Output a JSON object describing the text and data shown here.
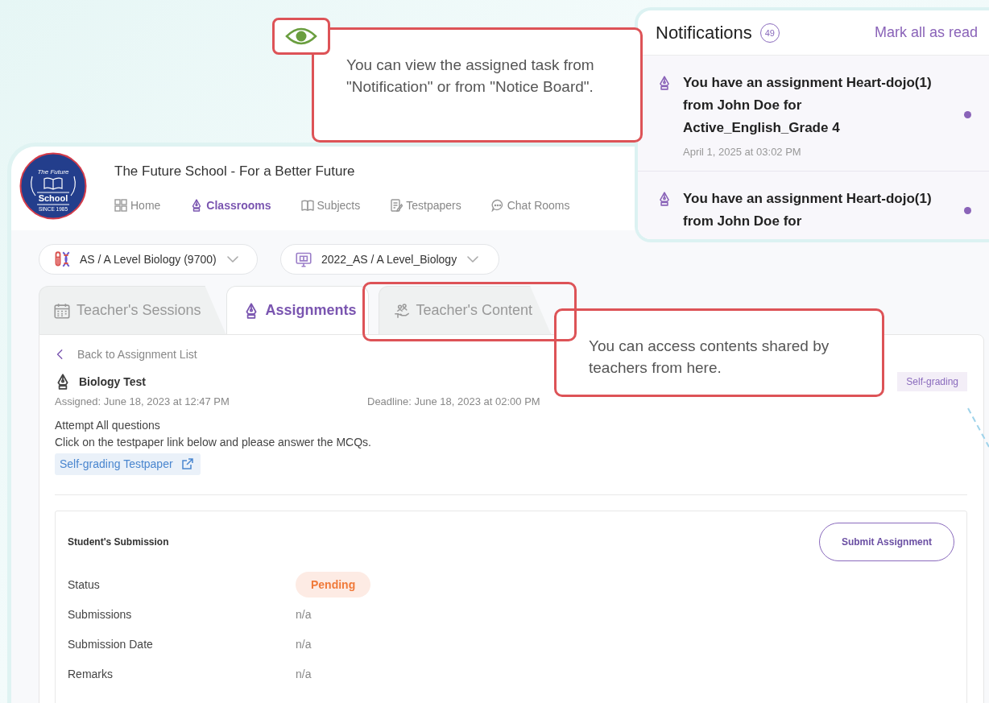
{
  "callouts": [
    {
      "kind": "eye",
      "text": "You can view the assigned task from \"Notification\" or from \"Notice Board\"."
    },
    {
      "kind": "highlight",
      "text": "You can access contents shared by teachers from here."
    }
  ],
  "notifications": {
    "title": "Notifications",
    "count": "49",
    "mark_all": "Mark all as read",
    "items": [
      {
        "text": "You have an assignment Heart-dojo(1) from John Doe for Active_English_Grade 4",
        "time": "April 1, 2025 at 03:02 PM",
        "unread": true
      },
      {
        "text": "You have an assignment Heart-dojo(1) from John Doe for",
        "unread": true
      }
    ]
  },
  "header": {
    "logo": {
      "top": "The Future",
      "main": "School",
      "since": "SINCE 1985"
    },
    "school_name": "The Future School - For a Better Future",
    "nav": [
      {
        "kind": "grid",
        "label": "Home",
        "selected": false
      },
      {
        "kind": "pen",
        "label": "Classrooms",
        "selected": true
      },
      {
        "kind": "book",
        "label": "Subjects",
        "selected": false
      },
      {
        "kind": "doc",
        "label": "Testpapers",
        "selected": false
      },
      {
        "kind": "chat",
        "label": "Chat Rooms",
        "selected": false
      }
    ]
  },
  "selectors": [
    {
      "kind": "dna",
      "label": "AS / A Level Biology (9700)"
    },
    {
      "kind": "monitor",
      "label": "2022_AS / A Level_Biology"
    }
  ],
  "tabs": [
    {
      "kind": "calendar",
      "label": "Teacher's Sessions",
      "selected": false
    },
    {
      "kind": "pen",
      "label": "Assignments",
      "selected": true
    },
    {
      "kind": "share",
      "label": "Teacher's Content",
      "selected": false
    }
  ],
  "assignment": {
    "back": "Back to Assignment List",
    "title": "Biology Test",
    "tag": "Self-grading",
    "assigned": "Assigned: June 18, 2023 at 12:47 PM",
    "deadline": "Deadline: June 18, 2023 at 02:00 PM",
    "description": [
      "Attempt All questions",
      "Click on the testpaper link below and please answer the MCQs."
    ],
    "link": "Self-grading Testpaper"
  },
  "submission": {
    "title": "Student's Submission",
    "button": "Submit Assignment",
    "rows": [
      {
        "kind": "badge",
        "label": "Status",
        "value": "Pending"
      },
      {
        "kind": "text",
        "label": "Submissions",
        "value": "n/a"
      },
      {
        "kind": "text",
        "label": "Submission Date",
        "value": "n/a"
      },
      {
        "kind": "text",
        "label": "Remarks",
        "value": "n/a"
      }
    ]
  }
}
